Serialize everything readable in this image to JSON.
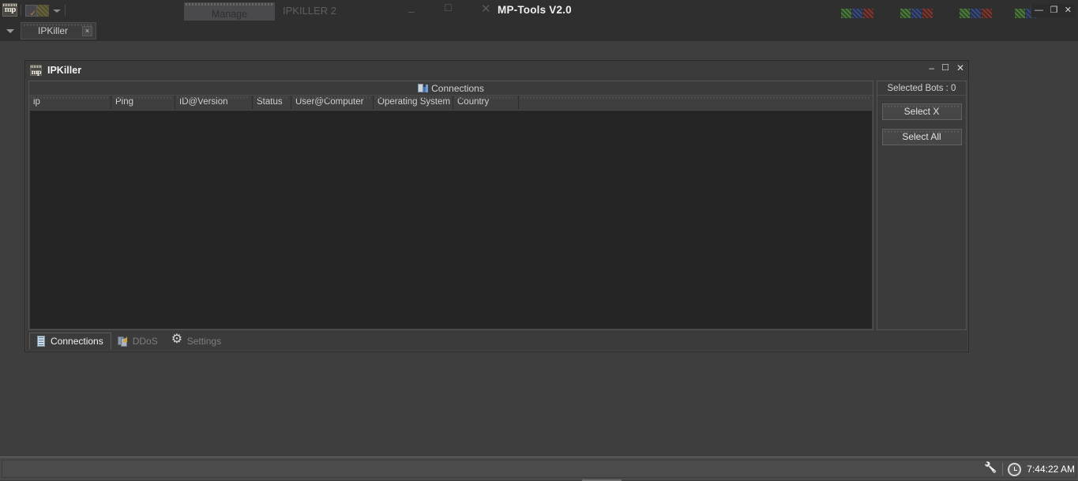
{
  "background_app": {
    "quick_access": {
      "logo_label": "mp",
      "icons": [
        "mp-logo-icon",
        "document-check-icon",
        "grid-icon",
        "chevron-down-icon"
      ]
    },
    "ribbon_tab": "Manage",
    "window_title": "IPKILLER 2",
    "window_controls": {
      "minimize": "–",
      "maximize": "☐",
      "close": "✕"
    }
  },
  "foreground_app": {
    "title": "MP-Tools V2.0",
    "window_controls": {
      "minimize": "—",
      "restore": "❐",
      "close": "✕"
    }
  },
  "tabstrip": {
    "dropdown_icon": "chevron-down-icon",
    "tab_label": "IPKiller",
    "tab_close": "×"
  },
  "ipkiller": {
    "title": "IPKiller",
    "icon_label": "mp",
    "window_controls": {
      "minimize": "–",
      "maximize": "☐",
      "close": "✕"
    },
    "connections": {
      "header": "Connections",
      "header_icon": "connections-icon",
      "columns": [
        {
          "label": "ip",
          "width": 104
        },
        {
          "label": "Ping",
          "width": 81
        },
        {
          "label": "ID@Version",
          "width": 98
        },
        {
          "label": "Status",
          "width": 49
        },
        {
          "label": "User@Computer",
          "width": 104
        },
        {
          "label": "Operating System",
          "width": 101
        },
        {
          "label": "Country",
          "width": 83
        }
      ],
      "rows": []
    },
    "bots_panel": {
      "header": "Selected Bots : 0",
      "selected_count": 0,
      "buttons": [
        {
          "label": "Select X",
          "name": "select-x-button"
        },
        {
          "label": "Select All",
          "name": "select-all-button"
        }
      ]
    },
    "tabs": [
      {
        "label": "Connections",
        "icon": "server-icon",
        "active": true
      },
      {
        "label": "DDoS",
        "icon": "ddos-icon",
        "active": false
      },
      {
        "label": "Settings",
        "icon": "gear-icon",
        "active": false
      }
    ]
  },
  "taskbar": {
    "tray_icons": [
      "wrench-icon",
      "clock-icon"
    ],
    "time": "7:44:22 AM"
  }
}
